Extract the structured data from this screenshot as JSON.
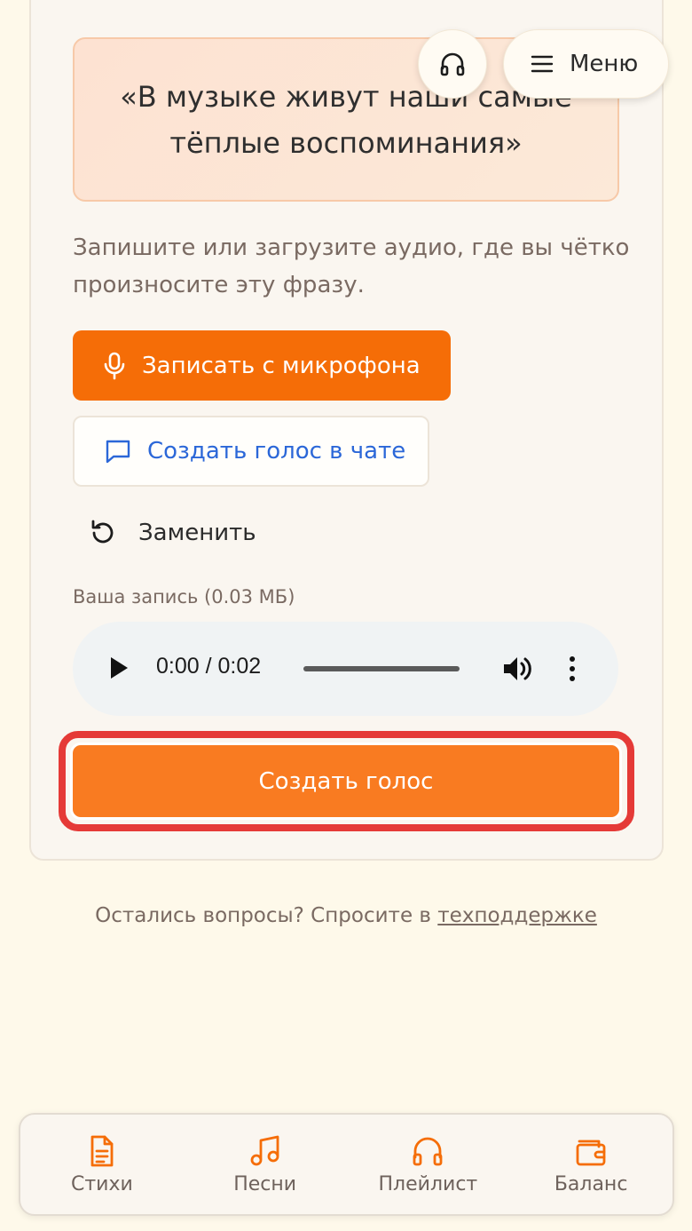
{
  "quote": {
    "text": "«В музыке живут наши самые тёплые воспоминания»"
  },
  "hint": "Запишите или загрузите аудио, где вы чётко произносите эту фразу.",
  "buttons": {
    "record_mic": "Записать с микрофона",
    "create_in_chat": "Создать голос в чате",
    "replace": "Заменить",
    "create_voice": "Создать голос"
  },
  "recording": {
    "label": "Ваша запись (0.03 МБ)",
    "time": "0:00 / 0:02",
    "progress_fraction": 0
  },
  "support": {
    "text": "Остались вопросы? Спросите в ",
    "link": "техподдержке"
  },
  "header": {
    "menu_label": "Меню"
  },
  "nav": [
    {
      "label": "Стихи",
      "icon": "document-icon"
    },
    {
      "label": "Песни",
      "icon": "music-note-icon"
    },
    {
      "label": "Плейлист",
      "icon": "headphones-icon"
    },
    {
      "label": "Баланс",
      "icon": "wallet-icon"
    }
  ],
  "colors": {
    "accent_orange": "#f56d07",
    "create_button": "#f97b21",
    "highlight_red": "#e53a37",
    "link_blue": "#2b67d8",
    "background": "#fef9ea"
  }
}
